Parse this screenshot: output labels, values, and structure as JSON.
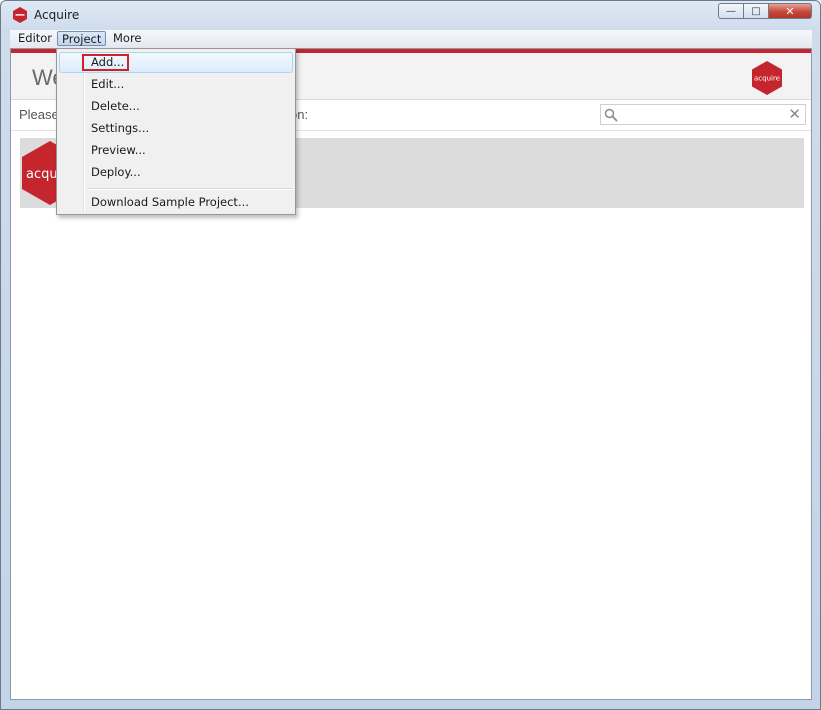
{
  "window": {
    "title": "Acquire",
    "controls": {
      "minimize": "—",
      "maximize": "□",
      "close": "✕"
    }
  },
  "app_icon": "acquire-logo-icon",
  "menubar": {
    "items": [
      {
        "label": "Editor"
      },
      {
        "label": "Project"
      },
      {
        "label": "More"
      }
    ]
  },
  "header": {
    "title_visible": "We",
    "logo_text": "acquire"
  },
  "filter": {
    "prompt_visible": "Please",
    "prompt_tail_visible": "on:",
    "search_placeholder": "",
    "search_value": ""
  },
  "project_tile": {
    "logo_text_visible": "acqu"
  },
  "project_menu": {
    "items": [
      {
        "label": "Add..."
      },
      {
        "label": "Edit..."
      },
      {
        "label": "Delete..."
      },
      {
        "label": "Settings..."
      },
      {
        "label": "Preview..."
      },
      {
        "label": "Deploy..."
      },
      {
        "label": "Download Sample Project..."
      }
    ]
  },
  "colors": {
    "brand_red": "#c5252d",
    "highlight_box": "#d0202a"
  }
}
